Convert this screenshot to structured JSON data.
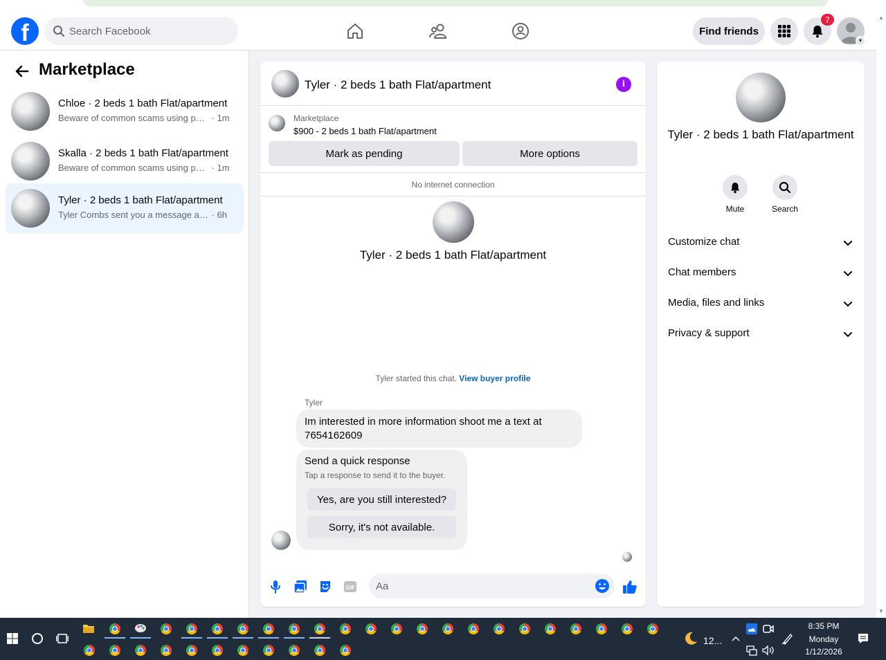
{
  "header": {
    "search_placeholder": "Search Facebook",
    "find_friends_label": "Find friends",
    "notification_count": "7",
    "brand_color": "#0866ff"
  },
  "sidebar": {
    "title": "Marketplace",
    "conversations": [
      {
        "title": "Chloe · 2 beds 1 bath Flat/apartment",
        "preview": "Beware of common scams using pay...",
        "time": "· 1m",
        "active": false
      },
      {
        "title": "Skalla · 2 beds 1 bath Flat/apartment",
        "preview": "Beware of common scams using pay...",
        "time": "· 1m",
        "active": false
      },
      {
        "title": "Tyler · 2 beds 1 bath Flat/apartment",
        "preview": "Tyler Combs sent you a message abo...",
        "time": "· 6h",
        "active": true
      }
    ]
  },
  "chat": {
    "title": "Tyler · 2 beds 1 bath Flat/apartment",
    "listing_source": "Marketplace",
    "listing_price": "$900 - 2 beds 1 bath Flat/apartment",
    "mark_pending_label": "Mark as pending",
    "more_options_label": "More options",
    "connection_status": "No internet connection",
    "center_title": "Tyler · 2 beds 1 bath Flat/apartment",
    "started_text": "Tyler started this chat.",
    "buyer_profile_link": "View buyer profile",
    "sender_name": "Tyler",
    "message_text": "Im interested in more information shoot me a text at 7654162609",
    "quick_response_title": "Send a quick response",
    "quick_response_subtitle": "Tap a response to send it to the buyer.",
    "quick_responses": [
      "Yes, are you still interested?",
      "Sorry, it's not available."
    ],
    "composer_placeholder": "Aa"
  },
  "info_panel": {
    "title": "Tyler · 2 beds 1 bath Flat/apartment",
    "actions": [
      {
        "label": "Mute",
        "icon": "bell-icon"
      },
      {
        "label": "Search",
        "icon": "search-icon"
      }
    ],
    "sections": [
      "Customize chat",
      "Chat members",
      "Media, files and links",
      "Privacy & support"
    ]
  },
  "taskbar": {
    "weather": "12...",
    "time": "8:35 PM",
    "day": "Monday",
    "date": "1/12/2026"
  }
}
